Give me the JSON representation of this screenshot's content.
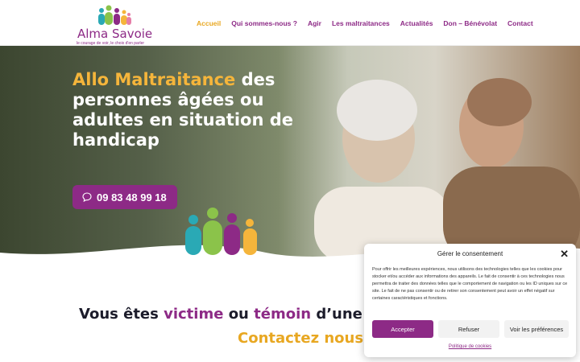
{
  "logo": {
    "title": "Alma Savoie",
    "tagline": "le courage de voir, le choix d'en parler"
  },
  "nav": [
    {
      "label": "Accueil",
      "active": true
    },
    {
      "label": "Qui sommes-nous ?"
    },
    {
      "label": "Agir"
    },
    {
      "label": "Les maltraitances"
    },
    {
      "label": "Actualités"
    },
    {
      "label": "Don – Bénévolat"
    },
    {
      "label": "Contact"
    }
  ],
  "hero": {
    "title_highlight": "Allo Maltraitance",
    "title_rest": " des personnes âgées ou adultes en situation de handicap",
    "phone": "09 83 48 99 18",
    "phone_icon": "chat-bubble-icon"
  },
  "content": {
    "p1": "Vous êtes ",
    "victime": "victime",
    "p2": " ou ",
    "temoin": "témoin",
    "p3": " d’une situatio",
    "contact": "Contactez nous"
  },
  "cookie": {
    "title": "Gérer le consentement",
    "text": "Pour offrir les meilleures expériences, nous utilisons des technologies telles que les cookies pour stocker et/ou accéder aux informations des appareils. Le fait de consentir à ces technologies nous permettra de traiter des données telles que le comportement de navigation ou les ID uniques sur ce site. Le fait de ne pas consentir ou de retirer son consentement peut avoir un effet négatif sur certaines caractéristiques et fonctions.",
    "accept": "Accepter",
    "refuse": "Refuser",
    "prefs": "Voir les préférences",
    "policy": "Politique de cookies"
  },
  "colors": {
    "purple": "#8d2a86",
    "gold": "#e8a721"
  }
}
